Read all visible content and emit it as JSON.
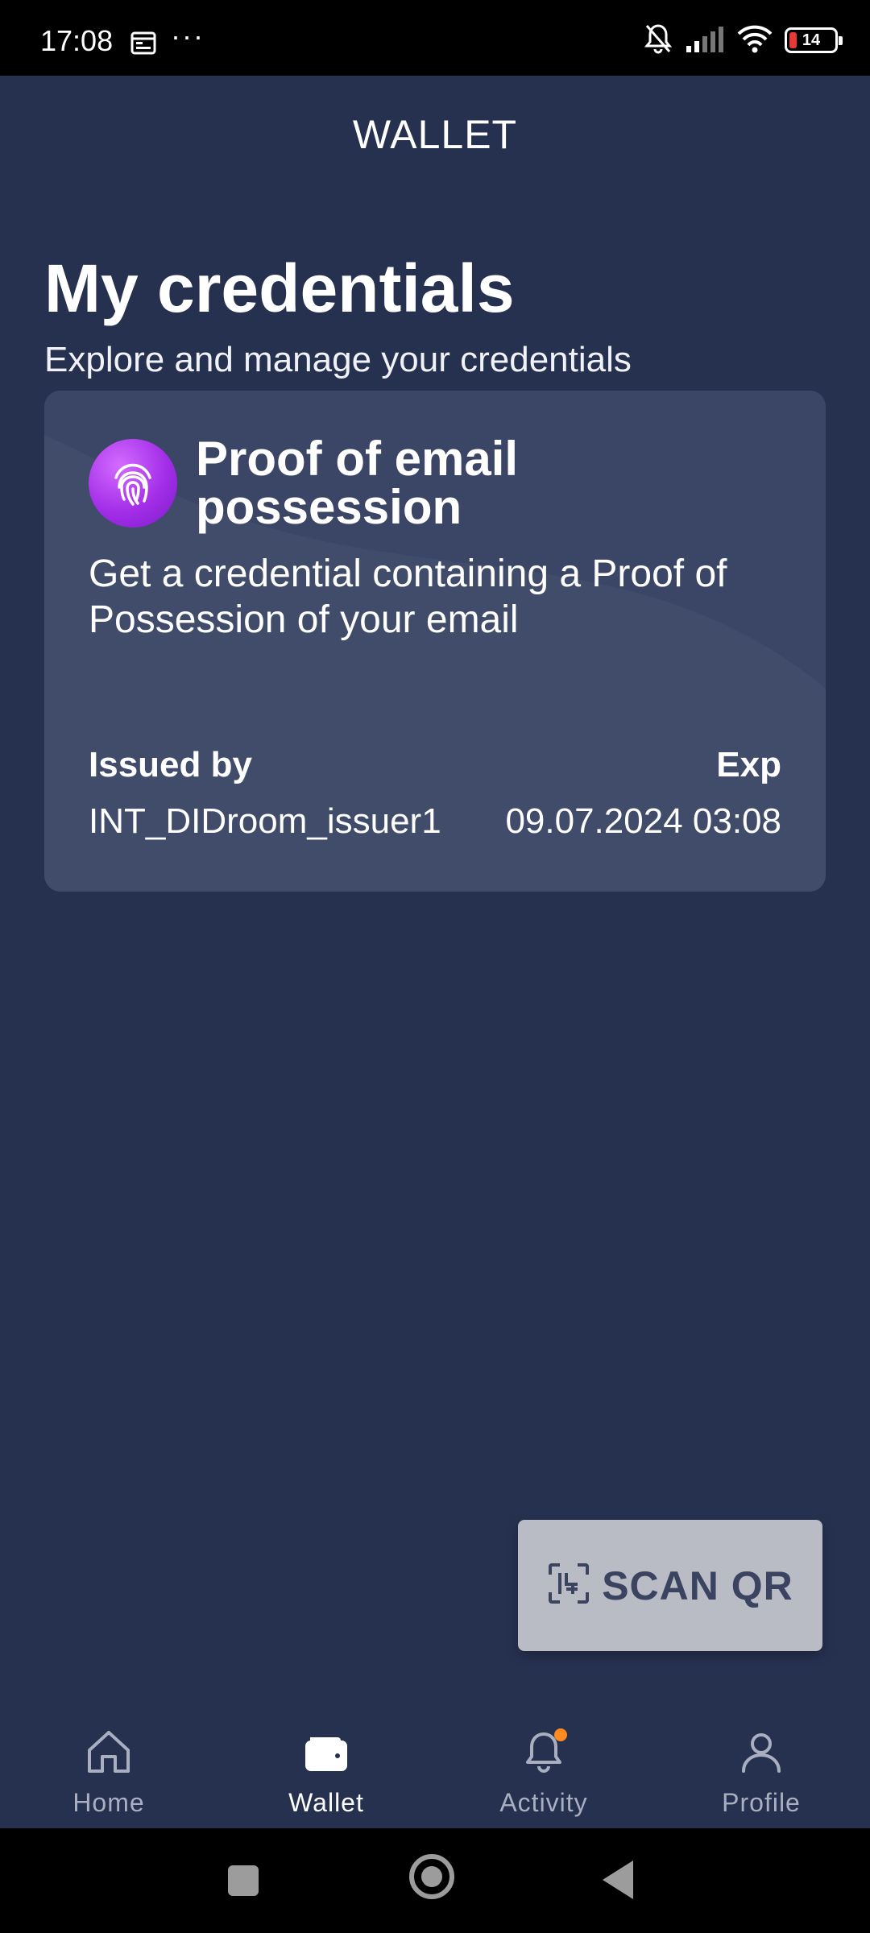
{
  "status_bar": {
    "time": "17:08",
    "dots": "···",
    "battery": "14",
    "icons": [
      "calendar-icon",
      "bell-muted-icon",
      "signal-icon",
      "wifi-icon",
      "battery-icon"
    ]
  },
  "header": {
    "title": "WALLET"
  },
  "main": {
    "title": "My credentials",
    "subtitle": "Explore and manage your credentials"
  },
  "credential": {
    "title": "Proof of email possession",
    "description": "Get a credential containing a Proof of Possession of your email",
    "issued_by_label": "Issued by",
    "issued_by_value": "INT_DIDroom_issuer1",
    "exp_label": "Exp",
    "exp_value": "09.07.2024 03:08",
    "icon": "fingerprint-icon"
  },
  "scan_button": {
    "label": "SCAN QR",
    "icon": "scan-qr-icon"
  },
  "bottom_nav": {
    "items": [
      {
        "label": "Home",
        "icon": "home-icon",
        "active": false
      },
      {
        "label": "Wallet",
        "icon": "wallet-icon",
        "active": true
      },
      {
        "label": "Activity",
        "icon": "bell-icon",
        "active": false
      },
      {
        "label": "Profile",
        "icon": "person-icon",
        "active": false
      }
    ]
  },
  "colors": {
    "background": "#263150",
    "card": "#414c6b",
    "accent_purple": "#a32ee8",
    "notification_dot": "#ff8a1f",
    "scan_button_bg": "#b9bcc4"
  }
}
